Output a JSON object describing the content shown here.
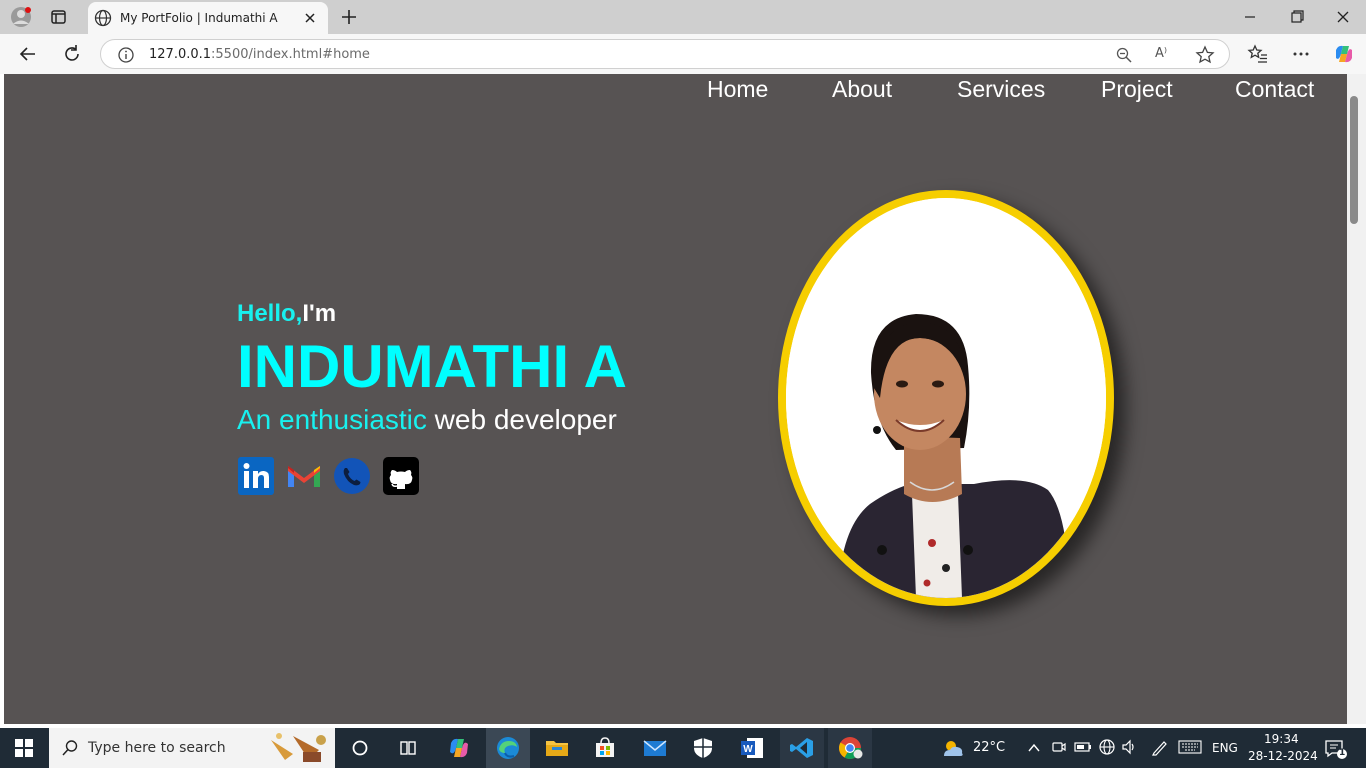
{
  "browser": {
    "tab_title": "My PortFolio | Indumathi A",
    "url_host": "127.0.0.1",
    "url_rest": ":5500/index.html#home"
  },
  "nav": {
    "items": [
      "Home",
      "About",
      "Services",
      "Project",
      "Contact"
    ]
  },
  "hero": {
    "hello": "Hello,",
    "im": "I'm",
    "name": "INDUMATHI A",
    "tagline_highlight": "An enthusiastic",
    "tagline_rest": " web developer"
  },
  "social": {
    "icons": [
      "linkedin-icon",
      "gmail-icon",
      "phone-icon",
      "github-icon"
    ]
  },
  "colors": {
    "page_bg": "#575353",
    "accent_cyan": "#00ffff",
    "photo_border": "#f6ce00"
  },
  "taskbar": {
    "search_placeholder": "Type here to search",
    "weather": "22°C",
    "language": "ENG",
    "time": "19:34",
    "date": "28-12-2024",
    "notification_count": "1"
  }
}
